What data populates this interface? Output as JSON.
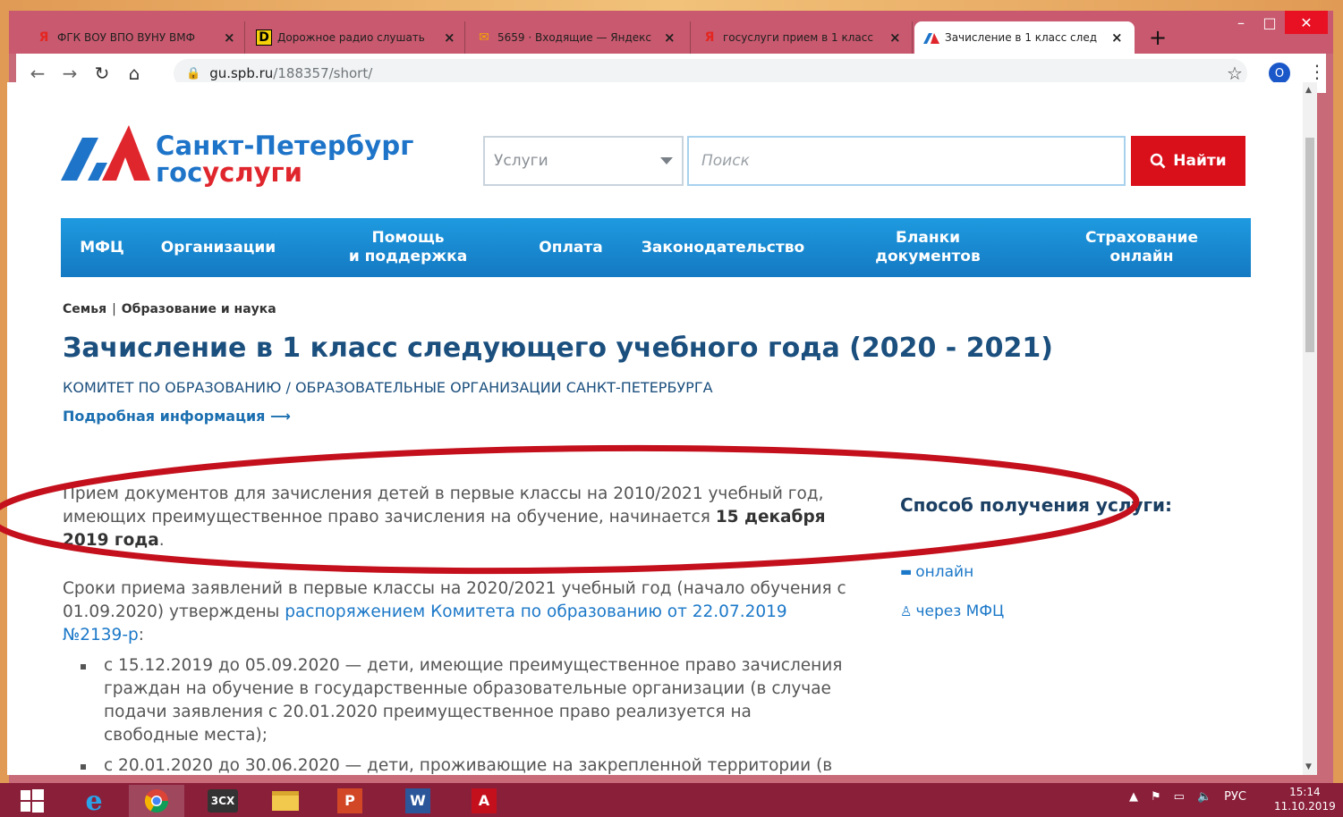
{
  "browser": {
    "tabs": [
      {
        "title": "ФГК ВОУ ВПО ВУНУ ВМФ",
        "icon": "yandex-icon"
      },
      {
        "title": "Дорожное радио слушать",
        "icon": "dorozhnoe-radio-icon"
      },
      {
        "title": "5659 · Входящие — Яндекс",
        "icon": "yandex-mail-icon"
      },
      {
        "title": "госуслуги прием в 1 класс",
        "icon": "yandex-icon"
      },
      {
        "title": "Зачисление в 1 класс след",
        "icon": "gosuslugi-icon"
      }
    ],
    "new_tab": "+",
    "url_host": "gu.spb.ru",
    "url_path": "/188357/short/",
    "profile_initial": "O"
  },
  "site": {
    "logo_title": "Санкт-Петербург",
    "logo_sub_a": "гос",
    "logo_sub_b": "услуги",
    "service_select": "Услуги",
    "search_placeholder": "Поиск",
    "search_button": "Найти",
    "nav": [
      {
        "label": "МФЦ"
      },
      {
        "label": "Организации"
      },
      {
        "label": "Помощь\nи поддержка"
      },
      {
        "label": "Оплата"
      },
      {
        "label": "Законодательство"
      },
      {
        "label": "Бланки\nдокументов"
      },
      {
        "label": "Страхование\nонлайн"
      }
    ]
  },
  "page": {
    "breadcrumb_1": "Семья",
    "breadcrumb_sep": "|",
    "breadcrumb_2": "Образование и наука",
    "title": "Зачисление в 1 класс следующего учебного года (2020 - 2021)",
    "org": "КОМИТЕТ ПО ОБРАЗОВАНИЮ / ОБРАЗОВАТЕЛЬНЫЕ ОРГАНИЗАЦИИ САНКТ-ПЕТЕРБУРГА",
    "more_link": "Подробная информация",
    "para1_text": "Прием документов для зачисления детей в первые классы на 2010/2021 учебный год, имеющих преимущественное право зачисления на обучение, начинается ",
    "para1_bold": "15 декабря 2019 года",
    "para1_end": ".",
    "para2_text": "Сроки приема заявлений в первые классы на 2020/2021 учебный год (начало обучения с 01.09.2020) утверждены ",
    "para2_link": "распоряжением Комитета по образованию от 22.07.2019 №2139-р",
    "para2_end": ":",
    "bullets": [
      "с 15.12.2019 до 05.09.2020 — дети, имеющие преимущественное право зачисления граждан на обучение в государственные образовательные организации (в случае подачи заявления с 20.01.2020 преимущественное право реализуется на свободные места);",
      "с 20.01.2020 до 30.06.2020 — дети, проживающие на закрепленной территории (в"
    ],
    "side_title": "Способ получения услуги:",
    "side_online": "онлайн",
    "side_mfc": "через МФЦ"
  },
  "taskbar": {
    "apps": [
      "windows-start",
      "internet-explorer",
      "chrome",
      "3cx",
      "file-explorer",
      "powerpoint",
      "word",
      "acrobat"
    ],
    "label_3cx": "3CX",
    "lang": "РУС",
    "time": "15:14",
    "date": "11.10.2019"
  },
  "colors": {
    "accent_blue": "#1e9ae0",
    "brand_red": "#d90f1a",
    "title_blue": "#1b4f7e",
    "annotation_red": "#c4101c"
  }
}
